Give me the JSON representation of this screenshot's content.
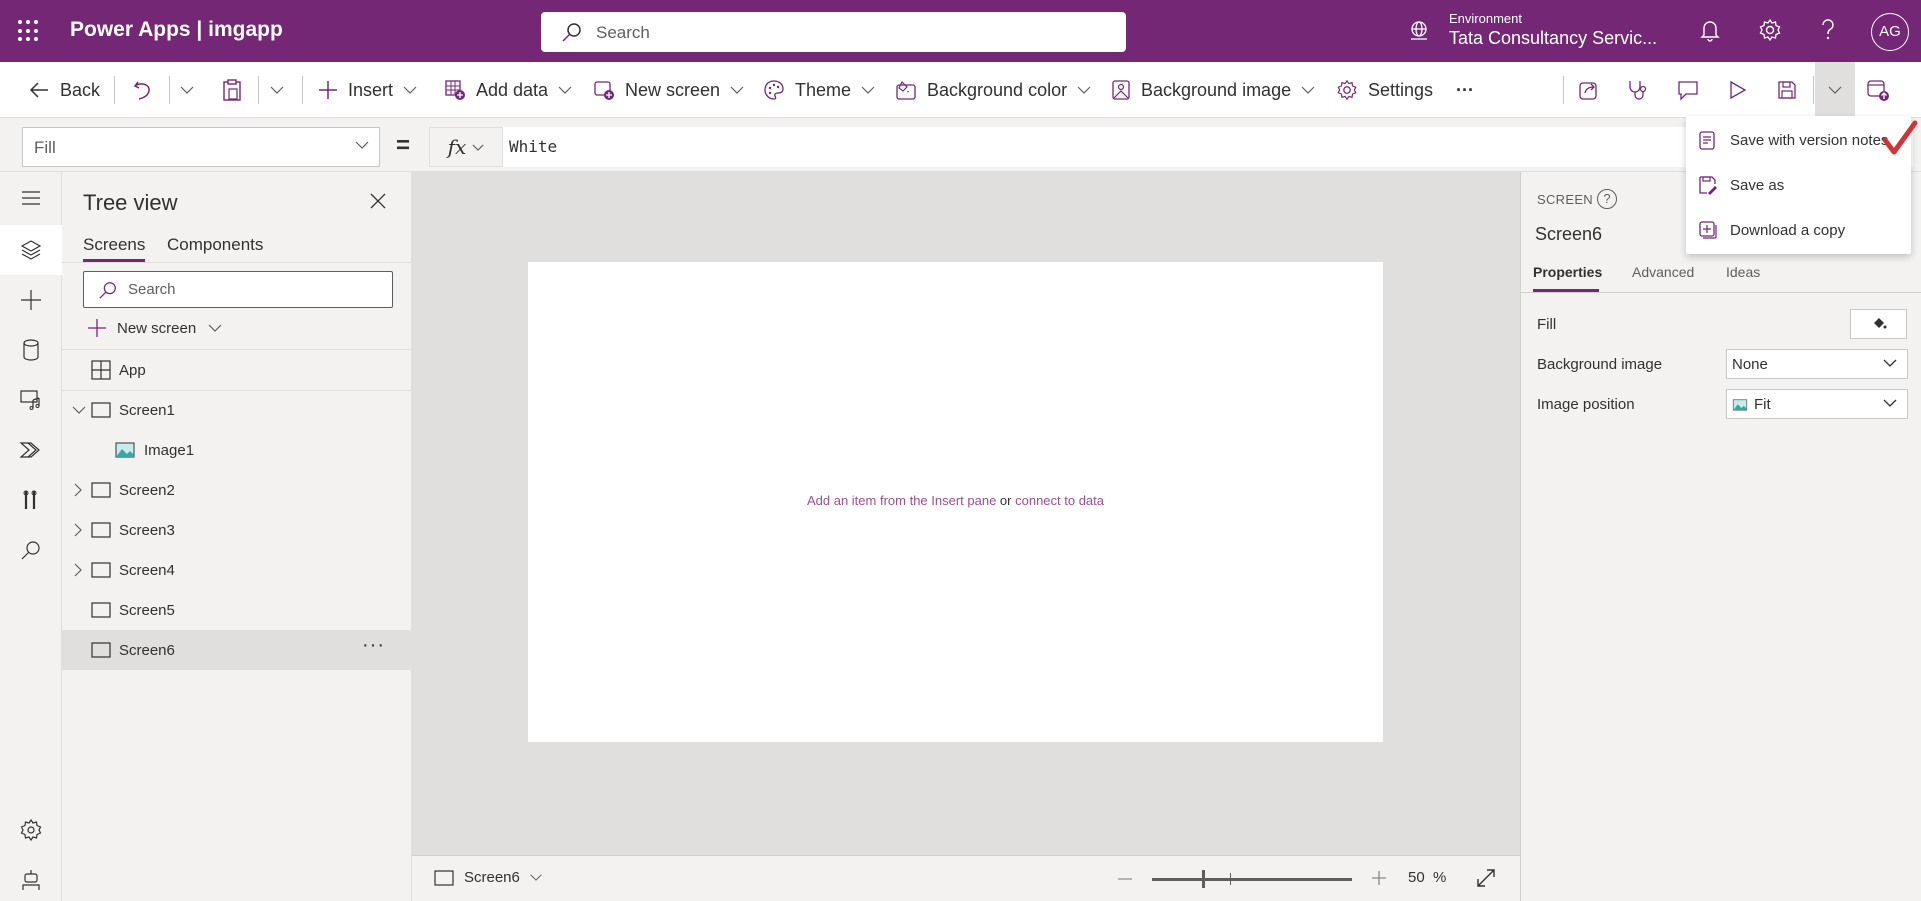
{
  "app": {
    "brand": "Power Apps | imgapp",
    "search_placeholder": "Search",
    "environment_label": "Environment",
    "environment_name": "Tata Consultancy Servic...",
    "avatar_initials": "AG"
  },
  "toolbar": {
    "back": "Back",
    "insert": "Insert",
    "add_data": "Add data",
    "new_screen": "New screen",
    "theme": "Theme",
    "background_color": "Background color",
    "background_image": "Background image",
    "settings": "Settings",
    "more": "···"
  },
  "formula_bar": {
    "property": "Fill",
    "equals": "=",
    "fx_label": "fx",
    "formula": "White"
  },
  "tree_view": {
    "title": "Tree view",
    "tabs": [
      "Screens",
      "Components"
    ],
    "active_tab": "Screens",
    "search_placeholder": "Search",
    "new_screen": "New screen",
    "nodes": [
      {
        "label": "App",
        "type": "app"
      },
      {
        "label": "Screen1",
        "type": "screen",
        "expanded": true
      },
      {
        "label": "Image1",
        "type": "image",
        "child": true
      },
      {
        "label": "Screen2",
        "type": "screen",
        "expandable": true
      },
      {
        "label": "Screen3",
        "type": "screen",
        "expandable": true
      },
      {
        "label": "Screen4",
        "type": "screen",
        "expandable": true
      },
      {
        "label": "Screen5",
        "type": "screen"
      },
      {
        "label": "Screen6",
        "type": "screen",
        "selected": true
      }
    ],
    "more": "···"
  },
  "canvas": {
    "hint_link1": "Add an item from the Insert pane",
    "hint_or": " or ",
    "hint_link2": "connect to data"
  },
  "status_bar": {
    "screen": "Screen6",
    "zoom_percent": 50,
    "zoom_value": "50",
    "zoom_unit": "%"
  },
  "properties_panel": {
    "type_label": "SCREEN",
    "help": "?",
    "name": "Screen6",
    "tabs": [
      "Properties",
      "Advanced",
      "Ideas"
    ],
    "active_tab": "Properties",
    "fill_label": "Fill",
    "background_image_label": "Background image",
    "background_image_value": "None",
    "image_position_label": "Image position",
    "image_position_value": "Fit"
  },
  "save_menu": {
    "items": [
      "Save with version notes",
      "Save as",
      "Download a copy"
    ]
  },
  "colors": {
    "brand": "#742774",
    "link": "#9b4f96",
    "annotation_check": "#d13438"
  }
}
